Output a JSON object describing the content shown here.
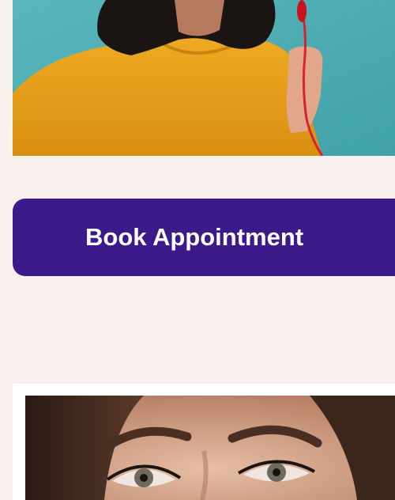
{
  "hero_image": {
    "subject": "woman-yellow-sweater-photo"
  },
  "cta": {
    "label": "Book Appointment",
    "background_color": "#3d1a8a",
    "text_color": "#ffffff"
  },
  "promo_card": {
    "image": {
      "subject": "woman-face-closeup-photo"
    }
  },
  "colors": {
    "page_background": "#f7f0ec",
    "hero_backdrop": "#4fb1b7",
    "sweater": "#e8a31c",
    "card_background": "#ffffff"
  }
}
